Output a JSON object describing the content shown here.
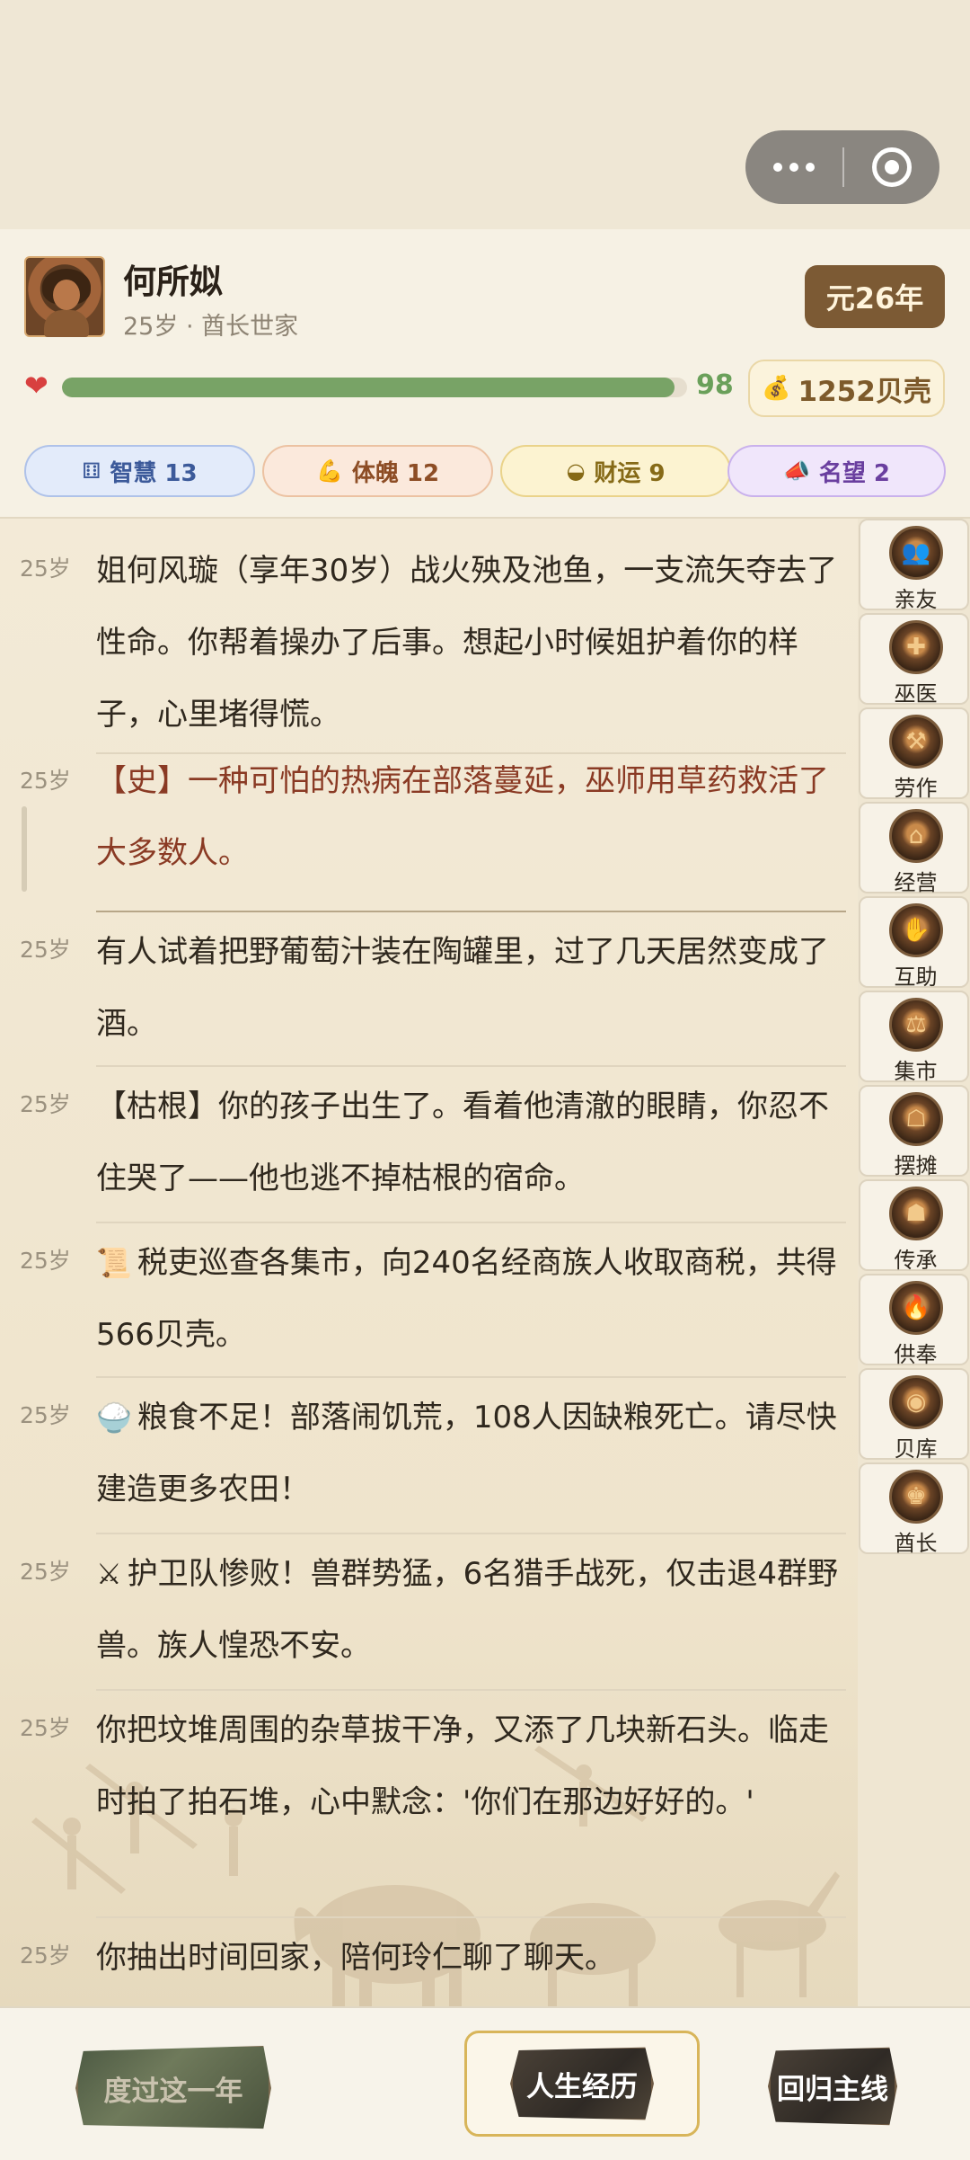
{
  "header": {
    "name": "何所姒",
    "subtitle": "25岁 · 酋长世家",
    "year": "元26年",
    "health": {
      "value": 98,
      "max": 100,
      "value_label": "98",
      "color": "#78a366"
    },
    "shells": "1252贝壳",
    "attributes": [
      {
        "key": "wisdom",
        "icon": "dice-icon",
        "label": "智慧 13"
      },
      {
        "key": "body",
        "icon": "muscle-icon",
        "label": "体魄 12"
      },
      {
        "key": "fortune",
        "icon": "gold-ingot-icon",
        "label": "财运 9"
      },
      {
        "key": "fame",
        "icon": "megaphone-icon",
        "label": "名望 2"
      }
    ]
  },
  "log": [
    {
      "age": "25岁",
      "text": "姐何风璇（享年30岁）战火殃及池鱼，一支流矢夺去了性命。你帮着操办了后事。想起小时候姐护着你的样子，心里堵得慌。"
    },
    {
      "age": "25岁",
      "text": "【史】一种可怕的热病在部落蔓延，巫师用草药救活了大多数人。",
      "type": "history"
    },
    {
      "age": "25岁",
      "text": "有人试着把野葡萄汁装在陶罐里，过了几天居然变成了酒。"
    },
    {
      "age": "25岁",
      "text": "【枯根】你的孩子出生了。看着他清澈的眼睛，你忍不住哭了——他也逃不掉枯根的宿命。"
    },
    {
      "age": "25岁",
      "icon": "scroll-icon",
      "emoji": "📜",
      "text": "税吏巡查各集市，向240名经商族人收取商税，共得566贝壳。"
    },
    {
      "age": "25岁",
      "icon": "rice-bowl-icon",
      "emoji": "🍚",
      "text": "粮食不足！部落闹饥荒，108人因缺粮死亡。请尽快建造更多农田！"
    },
    {
      "age": "25岁",
      "icon": "crossed-swords-icon",
      "emoji": "⚔️",
      "text": "护卫队惨败！兽群势猛，6名猎手战死，仅击退4群野兽。族人惶恐不安。"
    },
    {
      "age": "25岁",
      "text": "你把坟堆周围的杂草拔干净，又添了几块新石头。临走时拍了拍石堆，心中默念：'你们在那边好好的。'"
    },
    {
      "age": "25岁",
      "text": "你抽出时间回家，陪何玲仁聊了聊天。"
    }
  ],
  "sidebar": [
    {
      "label": "亲友",
      "icon": "family-icon",
      "glyph": "👥"
    },
    {
      "label": "巫医",
      "icon": "shaman-icon",
      "glyph": "✚"
    },
    {
      "label": "劳作",
      "icon": "tools-icon",
      "glyph": "⚒"
    },
    {
      "label": "经营",
      "icon": "hut-icon",
      "glyph": "⌂"
    },
    {
      "label": "互助",
      "icon": "handshake-icon",
      "glyph": "✋"
    },
    {
      "label": "集市",
      "icon": "market-icon",
      "glyph": "⚖"
    },
    {
      "label": "摆摊",
      "icon": "stall-icon",
      "glyph": "☖"
    },
    {
      "label": "传承",
      "icon": "elder-icon",
      "glyph": "☗"
    },
    {
      "label": "供奉",
      "icon": "fire-altar-icon",
      "glyph": "🔥"
    },
    {
      "label": "贝库",
      "icon": "treasury-icon",
      "glyph": "◉"
    },
    {
      "label": "酋长",
      "icon": "chief-icon",
      "glyph": "♚"
    }
  ],
  "bottom": {
    "pass_year": "度过这一年",
    "life_history": "人生经历",
    "return_main": "回归主线"
  }
}
